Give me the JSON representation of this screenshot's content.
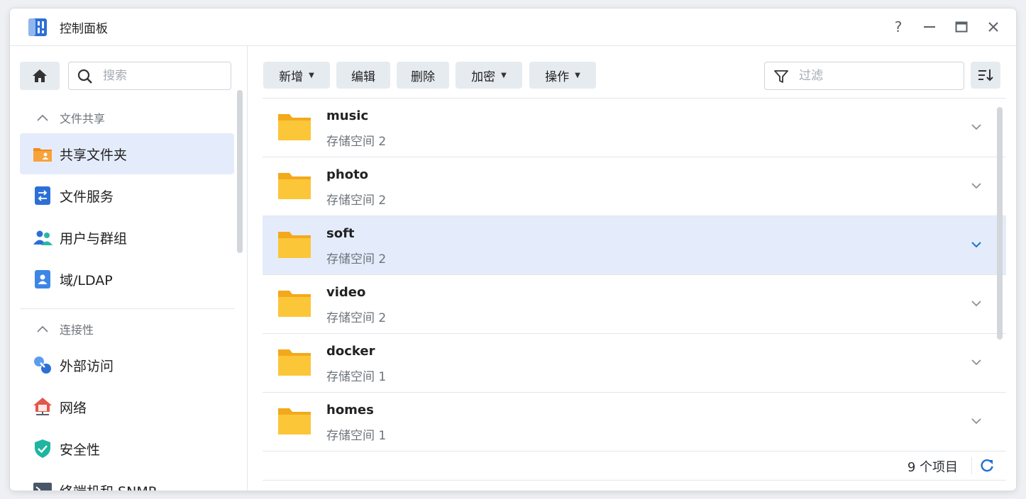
{
  "window": {
    "title": "控制面板"
  },
  "sidebar": {
    "search_placeholder": "搜索",
    "sections": [
      {
        "label": "文件共享",
        "items": [
          {
            "label": "共享文件夹",
            "icon": "shared-folder-icon",
            "active": true
          },
          {
            "label": "文件服务",
            "icon": "file-services-icon",
            "active": false
          },
          {
            "label": "用户与群组",
            "icon": "users-groups-icon",
            "active": false
          },
          {
            "label": "域/LDAP",
            "icon": "domain-ldap-icon",
            "active": false
          }
        ]
      },
      {
        "label": "连接性",
        "items": [
          {
            "label": "外部访问",
            "icon": "external-access-icon",
            "active": false
          },
          {
            "label": "网络",
            "icon": "network-icon",
            "active": false
          },
          {
            "label": "安全性",
            "icon": "security-icon",
            "active": false
          },
          {
            "label": "终端机和 SNMP",
            "icon": "terminal-snmp-icon",
            "active": false
          }
        ]
      }
    ]
  },
  "toolbar": {
    "create_label": "新增",
    "edit_label": "编辑",
    "delete_label": "删除",
    "encrypt_label": "加密",
    "action_label": "操作",
    "filter_placeholder": "过滤"
  },
  "folders": [
    {
      "name": "music",
      "location": "存储空间 2",
      "selected": false
    },
    {
      "name": "photo",
      "location": "存储空间 2",
      "selected": false
    },
    {
      "name": "soft",
      "location": "存储空间 2",
      "selected": true
    },
    {
      "name": "video",
      "location": "存储空间 2",
      "selected": false
    },
    {
      "name": "docker",
      "location": "存储空间 1",
      "selected": false
    },
    {
      "name": "homes",
      "location": "存储空间 1",
      "selected": false
    }
  ],
  "footer": {
    "item_count": "9 个项目"
  },
  "colors": {
    "accent": "#1f6fd1",
    "selected_bg": "#e4ecfb",
    "folder": "#fbbf2e"
  }
}
